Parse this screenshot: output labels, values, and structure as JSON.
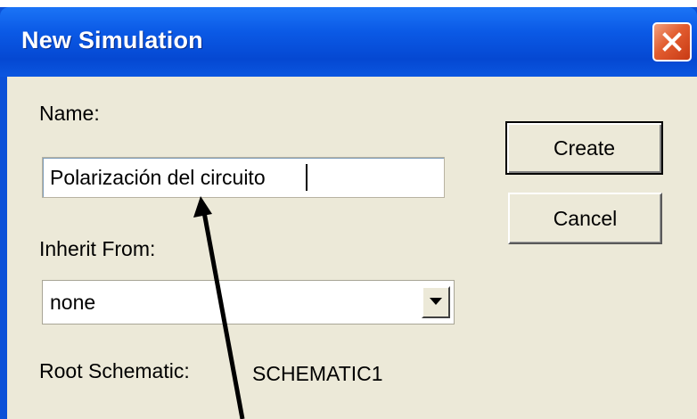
{
  "dialog": {
    "title": "New Simulation",
    "close_icon": "close-icon"
  },
  "form": {
    "name_label": "Name:",
    "name_value": "Polarización del circuito",
    "inherit_label": "Inherit From:",
    "inherit_value": "none",
    "root_label": "Root Schematic:",
    "root_value": "SCHEMATIC1"
  },
  "buttons": {
    "create": "Create",
    "cancel": "Cancel"
  },
  "colors": {
    "titlebar": "#0b5ae6",
    "client": "#ece9d8",
    "close": "#e25c2f"
  }
}
